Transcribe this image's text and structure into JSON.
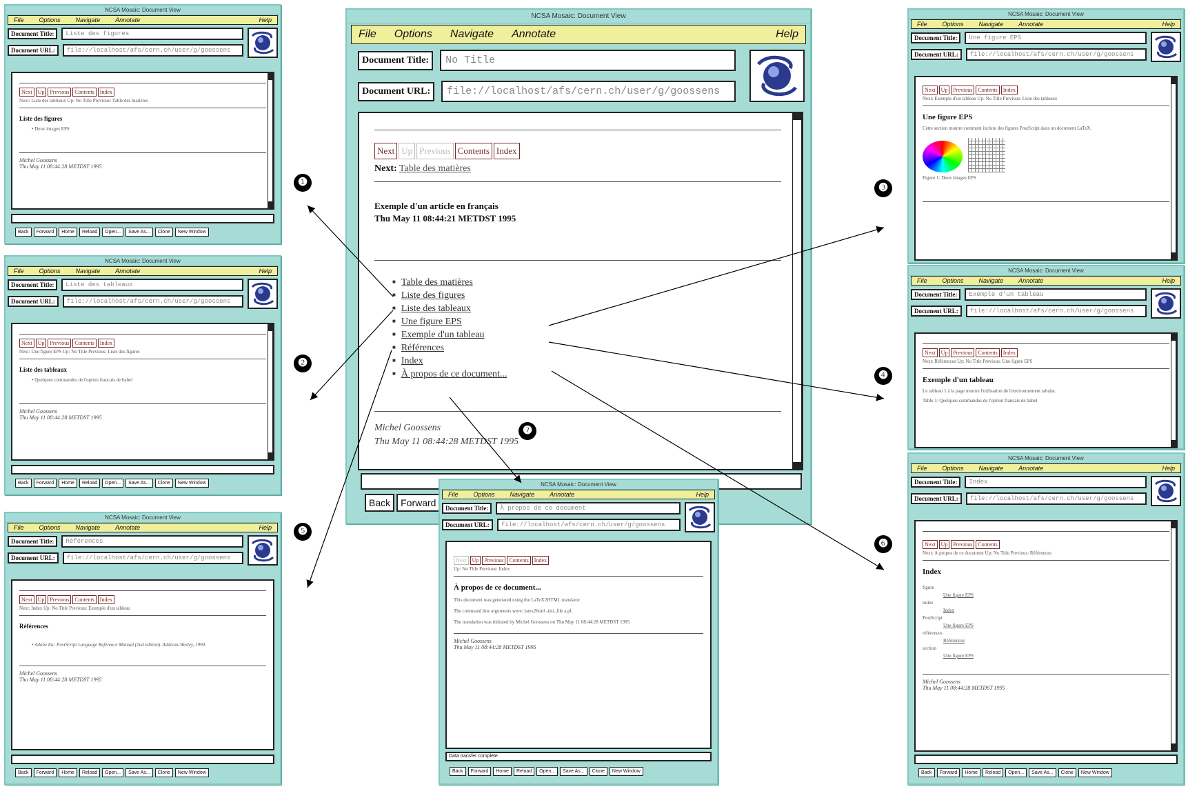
{
  "main": {
    "window_title": "NCSA Mosaic: Document View",
    "menu": {
      "file": "File",
      "options": "Options",
      "navigate": "Navigate",
      "annotate": "Annotate",
      "help": "Help"
    },
    "doc_title_label": "Document Title:",
    "doc_title_value": "No Title",
    "doc_url_label": "Document URL:",
    "doc_url_value": "file://localhost/afs/cern.ch/user/g/goossens",
    "nav": {
      "next": "Next",
      "up": "Up",
      "previous": "Previous",
      "contents": "Contents",
      "index": "Index"
    },
    "nav_line_label": "Next:",
    "nav_line_target": "Table des matières",
    "heading_line1": "Exemple d'un article en français",
    "heading_line2": "Thu May 11 08:44:21 METDST 1995",
    "toc": [
      "Table des matières",
      "Liste des figures",
      "Liste des tableaux",
      "Une figure EPS",
      "Exemple d'un tableau",
      "Références",
      "Index",
      "À propos de ce document..."
    ],
    "signature_name": "Michel Goossens",
    "signature_date": "Thu May 11 08:44:28 METDST 1995",
    "buttons": {
      "back": "Back",
      "forward": "Forward"
    }
  },
  "callouts": [
    "❶",
    "❷",
    "❸",
    "❹",
    "❺",
    "❻",
    "❼"
  ],
  "thumbs": {
    "common": {
      "window_title": "NCSA Mosaic: Document View",
      "menu": {
        "file": "File",
        "options": "Options",
        "navigate": "Navigate",
        "annotate": "Annotate",
        "help": "Help"
      },
      "title_label": "Document Title:",
      "url_label": "Document URL:",
      "url_value": "file://localhost/afs/cern.ch/user/g/goossens",
      "signature_name": "Michel Goossens",
      "signature_date": "Thu May 11 08:44:28 METDST 1995",
      "nav": {
        "next": "Next",
        "up": "Up",
        "previous": "Previous",
        "contents": "Contents",
        "index": "Index"
      },
      "bottom_buttons": [
        "Back",
        "Forward",
        "Home",
        "Reload",
        "Open...",
        "Save As...",
        "Clone",
        "New Window"
      ]
    },
    "t1": {
      "title_value": "Liste des figures",
      "nav_line": "Next: Liste des tableaux Up: No Title Previous: Table des matières",
      "heading": "Liste des figures",
      "items": [
        "Deux images EPS"
      ]
    },
    "t2": {
      "title_value": "Liste des tableaux",
      "nav_line": "Next: Une figure EPS Up: No Title Previous: Liste des figures",
      "heading": "Liste des tableaux",
      "items": [
        "Quelques commandes de l'option francais de babel"
      ]
    },
    "t5": {
      "title_value": "Références",
      "nav_line": "Next: Index Up: No Title Previous: Exemple d'un tableau",
      "heading": "Références",
      "items": [
        "Adobe Inc. PostScript Language Reference Manual (2nd edition). Addison-Wesley, 1990."
      ]
    },
    "t7": {
      "title_value": "À propos de ce document",
      "nav_line": "Up: No Title Previous: Index",
      "heading": "À propos de ce document...",
      "status": "Data transfer complete.",
      "items": [
        "This document was generated using the LaTeX2HTML translator.",
        "The command line arguments were: latex2html -init_file a.pl.",
        "The translation was initiated by Michel Goossens on Thu May 11 08:44:28 METDST 1995"
      ]
    },
    "t3": {
      "title_value": "Une figure EPS",
      "nav_line": "Next: Exemple d'un tableau Up: No Title Previous: Liste des tableaux",
      "heading": "Une figure EPS",
      "body": "Cette section montre comment inclure des figures PostScript dans un document LaTeX.",
      "caption": "Figure 1: Deux images EPS"
    },
    "t4": {
      "title_value": "Exemple d'un tableau",
      "nav_line": "Next: Références Up: No Title Previous: Une figure EPS",
      "heading": "Exemple d'un tableau",
      "body": "Le tableau 1 à la page montre l'utilisation de l'environnement tabular.",
      "caption": "Table 1: Quelques commandes de l'option francais de babel"
    },
    "t6": {
      "title_value": "Index",
      "nav_line": "Next: À propos de ce document Up: No Title Previous: Références",
      "heading": "Index",
      "items": [
        "figure",
        "Une figure EPS",
        "index",
        "Index",
        "PostScript",
        "Une figure EPS",
        "références",
        "Références",
        "section",
        "Une figure EPS"
      ]
    }
  }
}
